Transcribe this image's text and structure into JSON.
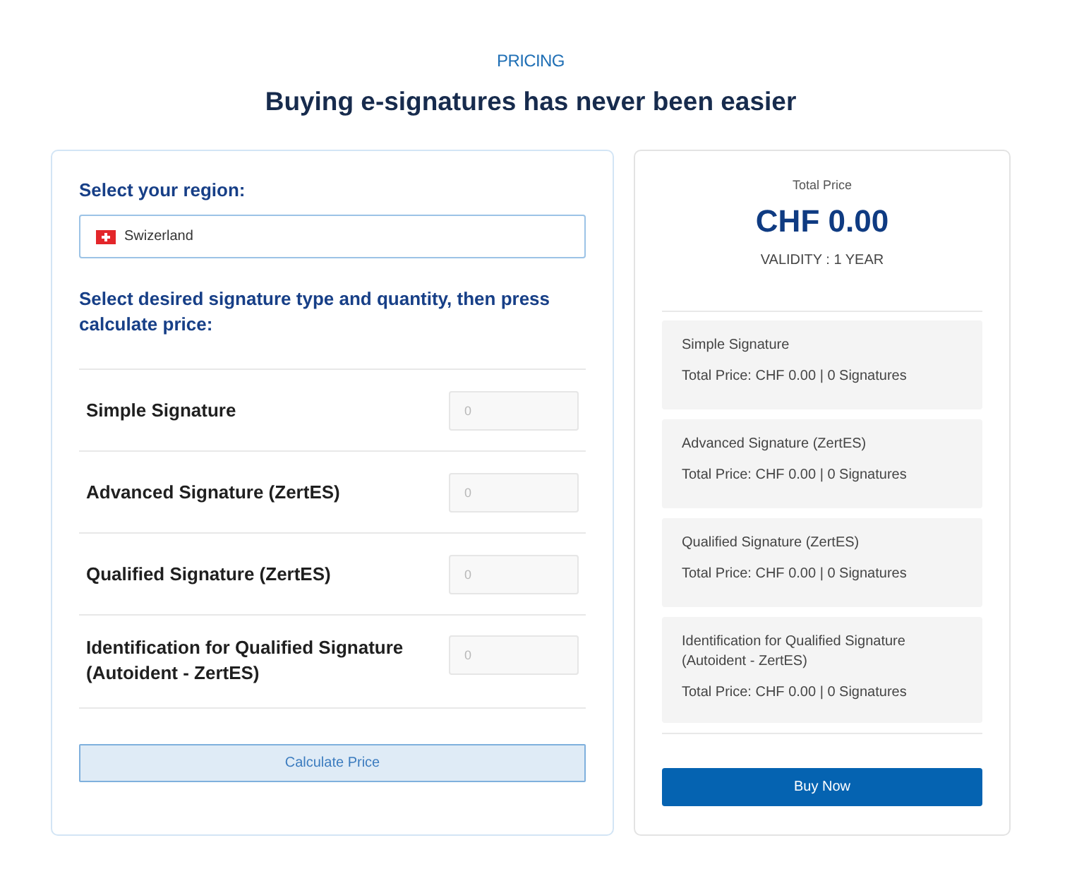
{
  "header": {
    "eyebrow": "PRICING",
    "title": "Buying e-signatures has never been easier"
  },
  "order_form": {
    "region_label": "Select your region:",
    "region": {
      "value": "Swizerland"
    },
    "instruction": "Select desired signature type and quantity, then press calculate price:",
    "products": [
      {
        "name": "Simple Signature",
        "quantity": {
          "placeholder": "0"
        }
      },
      {
        "name": "Advanced Signature (ZertES)",
        "quantity": {
          "placeholder": "0"
        }
      },
      {
        "name": "Qualified Signature (ZertES)",
        "quantity": {
          "placeholder": "0"
        }
      },
      {
        "name": "Identification for Qualified Signature (Autoident - ZertES)",
        "quantity": {
          "placeholder": "0"
        }
      }
    ],
    "calculate_button": "Calculate Price"
  },
  "summary": {
    "total_label": "Total Price",
    "total": "CHF 0.00",
    "validity": "VALIDITY : 1 YEAR",
    "items": [
      {
        "name": "Simple Signature",
        "detail": "Total Price: CHF 0.00 | 0 Signatures"
      },
      {
        "name": "Advanced Signature (ZertES)",
        "detail": "Total Price: CHF 0.00 | 0 Signatures"
      },
      {
        "name": "Qualified Signature (ZertES)",
        "detail": "Total Price: CHF 0.00 | 0 Signatures"
      },
      {
        "name": "Identification for Qualified Signature (Autoident - ZertES)",
        "detail": "Total Price: CHF 0.00 | 0 Signatures"
      }
    ],
    "buy_button": "Buy Now"
  }
}
